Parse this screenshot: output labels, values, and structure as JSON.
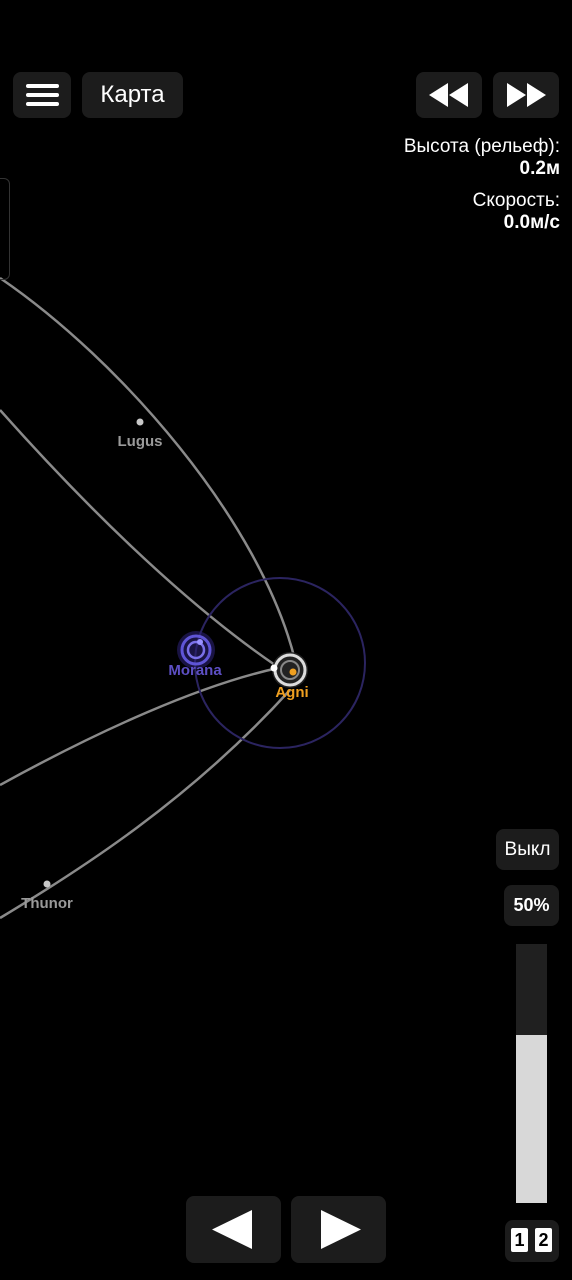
{
  "toolbar": {
    "menu_icon": "hamburger-icon",
    "map_label": "Карта",
    "rewind_icon": "rewind-icon",
    "fast_forward_icon": "fast-forward-icon"
  },
  "telemetry": {
    "altitude_label": "Высота (рельеф):",
    "altitude_value": "0.2м",
    "speed_label": "Скорость:",
    "speed_value": "0.0м/с"
  },
  "map": {
    "bodies": [
      {
        "name": "Lugus",
        "color": "#9a9a9a"
      },
      {
        "name": "Morana",
        "color": "#5d4fc4"
      },
      {
        "name": "Agni",
        "color": "#f0a020"
      },
      {
        "name": "Thunor",
        "color": "#9a9a9a"
      }
    ]
  },
  "controls": {
    "off_label": "Выкл",
    "throttle_label": "50%",
    "throttle_level": 0.65,
    "prev_icon": "arrow-left-icon",
    "next_icon": "arrow-right-icon",
    "page_1": "1",
    "page_2": "2"
  }
}
